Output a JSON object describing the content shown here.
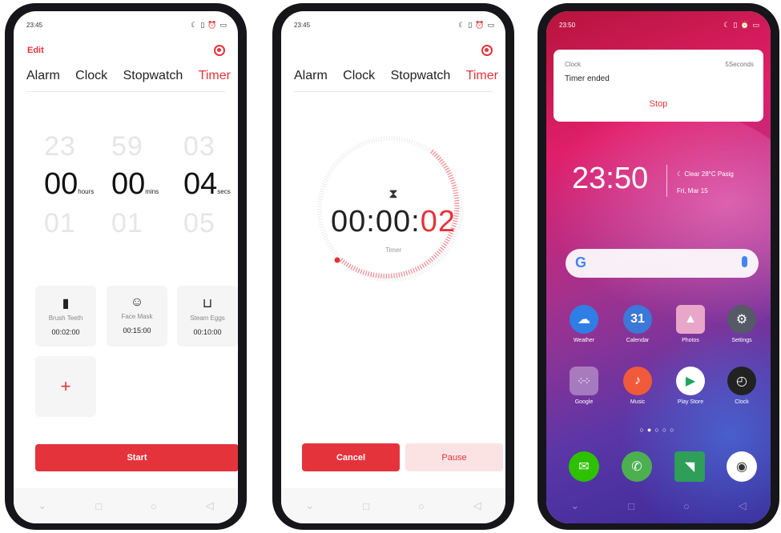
{
  "colors": {
    "accent": "#e5333c",
    "accent_light": "#fbe3e4"
  },
  "screen1": {
    "status_time": "23:45",
    "edit_label": "Edit",
    "tabs": [
      "Alarm",
      "Clock",
      "Stopwatch",
      "Timer"
    ],
    "active_tab": "Timer",
    "picker": {
      "prev": [
        "23",
        "59",
        "03"
      ],
      "current": [
        "00",
        "00",
        "04"
      ],
      "next": [
        "01",
        "01",
        "05"
      ],
      "units": [
        "hours",
        "mins",
        "secs"
      ]
    },
    "presets": [
      {
        "icon": "door-icon",
        "name": "Brush Teeth",
        "time": "00:02:00"
      },
      {
        "icon": "face-icon",
        "name": "Face Mask",
        "time": "00:15:00"
      },
      {
        "icon": "pot-icon",
        "name": "Steam Eggs",
        "time": "00:10:00"
      }
    ],
    "add_label": "+",
    "start_label": "Start"
  },
  "screen2": {
    "status_time": "23:45",
    "tabs": [
      "Alarm",
      "Clock",
      "Stopwatch",
      "Timer"
    ],
    "active_tab": "Timer",
    "time_prefix": "00:00:",
    "time_secs": "02",
    "timer_label": "Timer",
    "cancel_label": "Cancel",
    "pause_label": "Pause"
  },
  "screen3": {
    "status_time": "23:50",
    "notification": {
      "app": "Clock",
      "when": "5Seconds",
      "message": "Timer ended",
      "action": "Stop"
    },
    "clock": "23:50",
    "weather": "Clear 28°C",
    "location": "Pasig",
    "date": "Fri, Mar 15",
    "apps_row1": [
      {
        "label": "Weather",
        "color": "#2f7ee6"
      },
      {
        "label": "Calendar",
        "color": "#3b78d8"
      },
      {
        "label": "Photos",
        "color": "#e8a7c8"
      },
      {
        "label": "Settings",
        "color": "#555a66"
      }
    ],
    "apps_row2": [
      {
        "label": "Google",
        "color": "#e8e8f0"
      },
      {
        "label": "Music",
        "color": "#f05a3a"
      },
      {
        "label": "Play Store",
        "color": "#ffffff"
      },
      {
        "label": "Clock",
        "color": "#222222"
      }
    ],
    "calendar_day": "31",
    "page_dots": "○●○○○",
    "dock": [
      {
        "label": "WeChat",
        "color": "#2dc100"
      },
      {
        "label": "Phone",
        "color": "#4caf50"
      },
      {
        "label": "Messages",
        "color": "#2e9e58"
      },
      {
        "label": "Camera",
        "color": "#ffffff"
      }
    ]
  }
}
